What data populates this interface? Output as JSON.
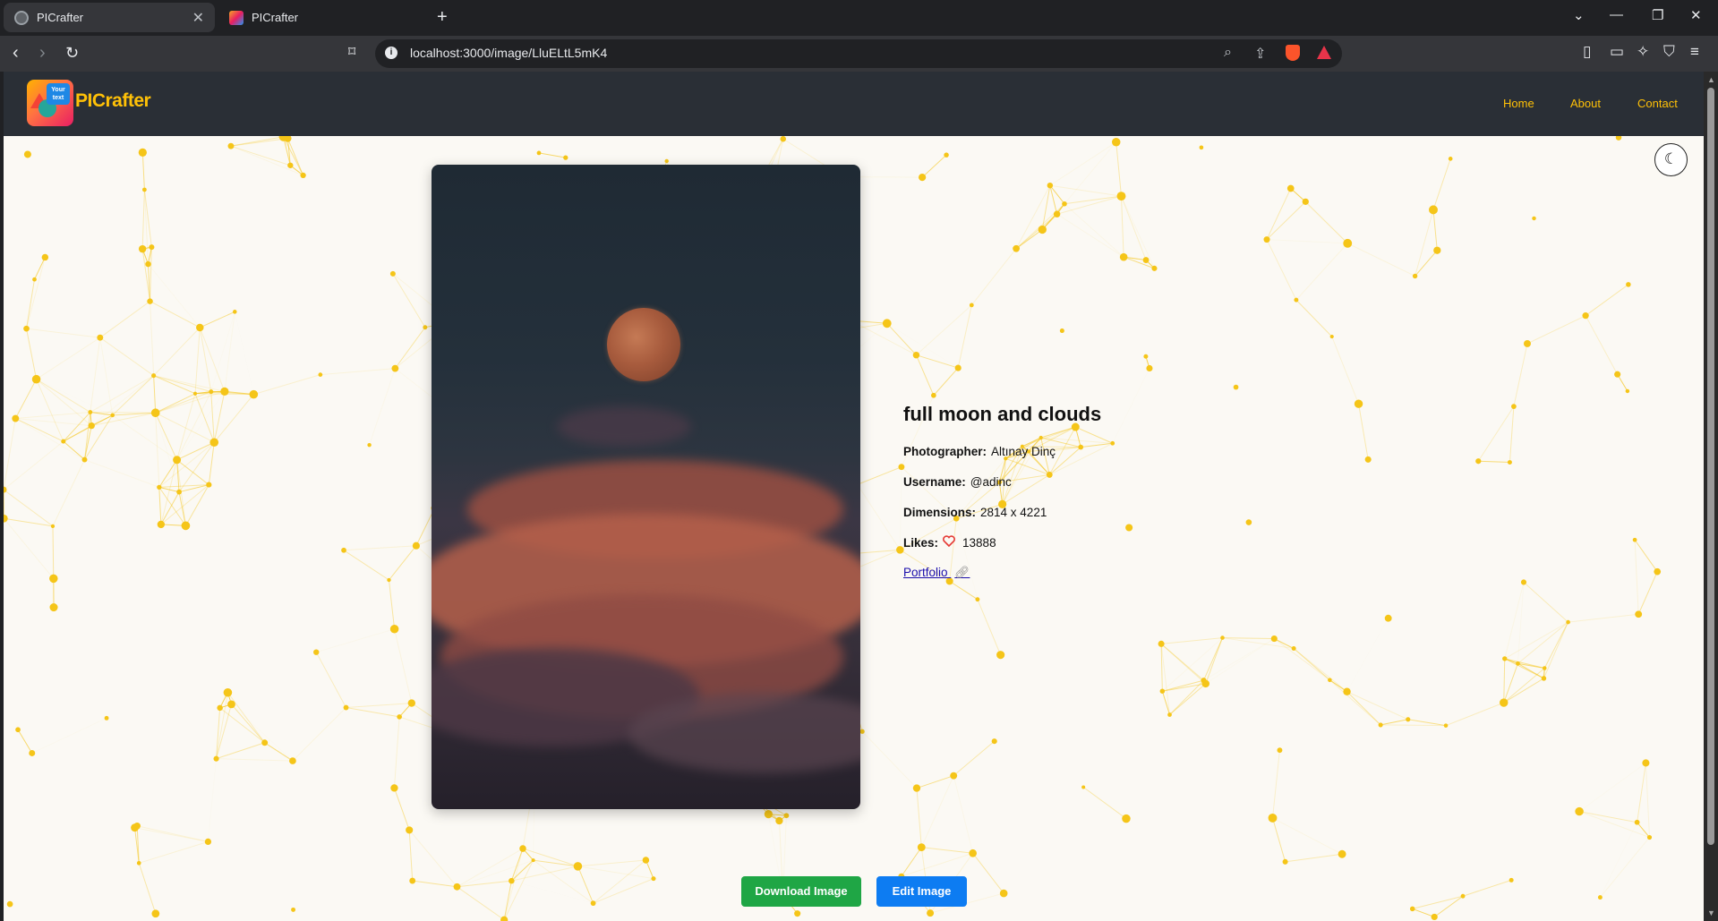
{
  "browser": {
    "tabs": [
      {
        "title": "PICrafter",
        "active": true
      },
      {
        "title": "PICrafter",
        "active": false
      }
    ],
    "url": "localhost:3000/image/LluELtL5mK4"
  },
  "app": {
    "brand": "PICrafter",
    "logo_text": "Your text",
    "nav": [
      "Home",
      "About",
      "Contact"
    ]
  },
  "image": {
    "title": "full moon and clouds",
    "photographer_label": "Photographer:",
    "photographer": "Altınay Dinç",
    "username_label": "Username:",
    "username": "@adinc",
    "dimensions_label": "Dimensions:",
    "dimensions": "2814 x 4221",
    "likes_label": "Likes:",
    "likes": "13888",
    "portfolio": "Portfolio"
  },
  "actions": {
    "download": "Download Image",
    "edit": "Edit Image"
  },
  "colors": {
    "accent": "#ffc107",
    "nav_bg": "#2a2f36",
    "download": "#1fa645",
    "edit": "#0d7cf2",
    "network": "#f5c518"
  }
}
